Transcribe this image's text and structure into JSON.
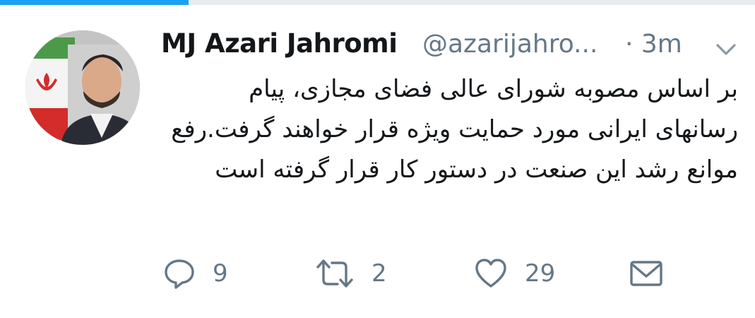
{
  "progress": {
    "fraction": 0.25,
    "color": "#1da1f2"
  },
  "tweet": {
    "author_name": "MJ Azari Jahromi",
    "author_handle": "@azarijahro...",
    "time_separator": "·",
    "time_ago": "3m",
    "text": "بر اساس مصوبه شورای عالی فضای مجازی، پیام رسانهای ایرانی مورد حمایت ویژه قرار خواهند گرفت.رفع موانع رشد این صنعت در دستور کار قرار گرفته است"
  },
  "actions": {
    "reply": {
      "icon": "reply-icon",
      "count": "9"
    },
    "retweet": {
      "icon": "retweet-icon",
      "count": "2"
    },
    "like": {
      "icon": "heart-icon",
      "count": "29"
    },
    "dm": {
      "icon": "envelope-icon"
    }
  },
  "colors": {
    "muted": "#657786",
    "text": "#14171a",
    "accent": "#1da1f2"
  }
}
